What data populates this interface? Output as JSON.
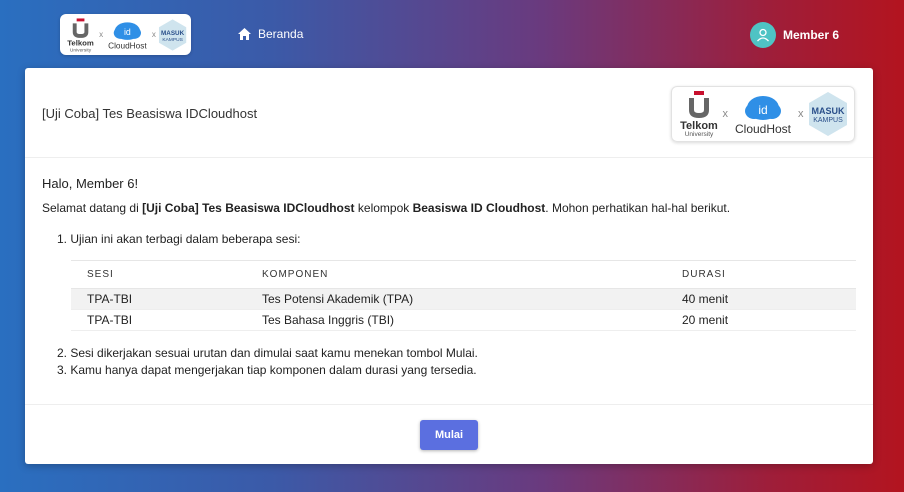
{
  "brand": {
    "telkom_text": "Telkom",
    "telkom_sub": "University",
    "cloud_text": "CloudHost",
    "cloud_badge": "id",
    "masuk_text": "MASUK",
    "kampus_text": "KAMPUS",
    "separator": "x"
  },
  "nav": {
    "home_label": "Beranda",
    "home_icon": "home-icon"
  },
  "user": {
    "name": "Member 6",
    "avatar_icon": "user-icon"
  },
  "card": {
    "title": "[Uji Coba] Tes Beasiswa IDCloudhost"
  },
  "content": {
    "greeting": "Halo, Member 6!",
    "welcome_prefix": "Selamat datang di ",
    "welcome_exam": "[Uji Coba] Tes Beasiswa IDCloudhost",
    "welcome_mid": " kelompok ",
    "welcome_group": "Beasiswa ID Cloudhost",
    "welcome_suffix": ". Mohon perhatikan hal-hal berikut.",
    "item1": "1. Ujian ini akan terbagi dalam beberapa sesi:",
    "item2": "2. Sesi dikerjakan sesuai urutan dan dimulai saat kamu menekan tombol Mulai.",
    "item3": "3. Kamu hanya dapat mengerjakan tiap komponen dalam durasi yang tersedia."
  },
  "table": {
    "headers": {
      "sesi": "SESI",
      "komponen": "KOMPONEN",
      "durasi": "DURASI"
    },
    "rows": [
      {
        "sesi": "TPA-TBI",
        "komponen": "Tes Potensi Akademik (TPA)",
        "durasi": "40 menit"
      },
      {
        "sesi": "TPA-TBI",
        "komponen": "Tes Bahasa Inggris (TBI)",
        "durasi": "20 menit"
      }
    ]
  },
  "actions": {
    "start_label": "Mulai"
  },
  "colors": {
    "accent": "#5b6fe0",
    "avatar": "#4fc3c4",
    "telkom_red": "#c8102e",
    "cloud_blue": "#2f8fe6"
  }
}
